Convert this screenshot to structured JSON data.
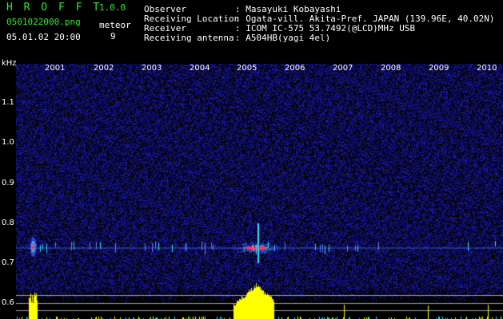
{
  "header": {
    "app_title": "H R O F F T",
    "app_version": "1.0.0",
    "filename": "0501022000.png",
    "meteor_label": "meteor",
    "meteor_count": "9",
    "datetime": "05.01.02 20:00",
    "fields": [
      {
        "label": "Observer",
        "value": ": Masayuki Kobayashi"
      },
      {
        "label": "Receiving Location",
        "value": ": Ogata-vill. Akita-Pref. JAPAN (139.96E, 40.02N)"
      },
      {
        "label": "Receiver",
        "value": ": ICOM IC-575 53.7492(@LCD)MHz USB"
      },
      {
        "label": "Receiving antenna",
        "value": ": A504HB(yagi 4el)"
      }
    ]
  },
  "chart_data": {
    "type": "heatmap",
    "ylabel": "kHz",
    "x_ticks": [
      "2001",
      "2002",
      "2003",
      "2004",
      "2005",
      "2006",
      "2007",
      "2008",
      "2009",
      "2010"
    ],
    "y_ticks": [
      "1.1",
      "1.0",
      "0.9",
      "0.8",
      "0.7",
      "0.6"
    ],
    "colors": {
      "background": "#000000",
      "noise": "#1a1aa6",
      "signal": "#ffff00",
      "peak": "#ff2a6a",
      "cyan": "#30e0ff"
    }
  }
}
